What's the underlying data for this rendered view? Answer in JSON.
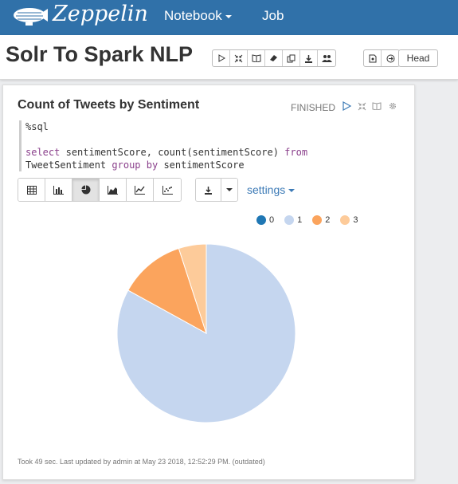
{
  "app": {
    "brand": "Zeppelin"
  },
  "nav": {
    "notebook_label": "Notebook",
    "job_label": "Job"
  },
  "notebook": {
    "title": "Solr To Spark NLP",
    "head_label": "Head"
  },
  "paragraph": {
    "title": "Count of Tweets by Sentiment",
    "status": "FINISHED",
    "code_lines": [
      "%sql",
      "",
      "select sentimentScore, count(sentimentScore)  from",
      "    TweetSentiment group by sentimentScore"
    ],
    "settings_label": "settings",
    "footer": "Took 49 sec. Last updated by admin at May 23 2018, 12:52:29 PM. (outdated)"
  },
  "chart_data": {
    "type": "pie",
    "categories": [
      "0",
      "1",
      "2",
      "3"
    ],
    "values": [
      0,
      83,
      12,
      5
    ],
    "colors": [
      "#1f77b4",
      "#c5d6ef",
      "#fba45d",
      "#fdcb9a"
    ],
    "legend_position": "top-right"
  }
}
